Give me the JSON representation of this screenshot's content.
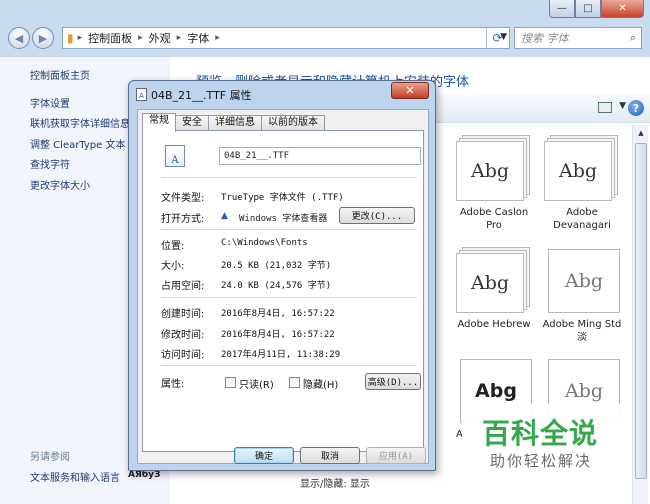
{
  "explorer": {
    "controls": {
      "minimize": "—",
      "maximize": "□",
      "close": "✕"
    },
    "breadcrumb": [
      "控制面板",
      "外观",
      "字体"
    ],
    "search_placeholder": "搜索 字体",
    "sidebar": {
      "home": "控制面板主页",
      "links": [
        "字体设置",
        "联机获取字体详细信息",
        "调整 ClearType 文本",
        "查找字符",
        "更改字体大小"
      ],
      "see_also_title": "另请参阅",
      "see_also_links": [
        "文本服务和输入语言"
      ]
    },
    "main_title": "预览、删除或者显示和隐藏计算机上安装的字体",
    "fonts": [
      {
        "sample": "Abg",
        "name": "Adobe Caslon Pro"
      },
      {
        "sample": "Abg",
        "name": "Adobe Devanagari"
      },
      {
        "sample": "Abg",
        "name": "Adobe Hebrew"
      },
      {
        "sample": "Abg",
        "name": "Adobe Ming Std 淡"
      },
      {
        "sample": "Abg",
        "name": "A"
      },
      {
        "sample": "Abg",
        "name": ""
      }
    ],
    "status_text": "显示/隐藏: 显示"
  },
  "dialog": {
    "title": "04B_21__.TTF 属性",
    "close": "✕",
    "tabs": [
      "常规",
      "安全",
      "详细信息",
      "以前的版本"
    ],
    "filename": "04B_21__.TTF",
    "rows": {
      "type_label": "文件类型:",
      "type_value": "TrueType 字体文件 (.TTF)",
      "open_label": "打开方式:",
      "open_value": "Windows 字体查看器",
      "change_btn": "更改(C)...",
      "location_label": "位置:",
      "location_value": "C:\\Windows\\Fonts",
      "size_label": "大小:",
      "size_value": "20.5 KB (21,032 字节)",
      "disk_label": "占用空间:",
      "disk_value": "24.0 KB (24,576 字节)",
      "created_label": "创建时间:",
      "created_value": "2016年8月4日, 16:57:22",
      "modified_label": "修改时间:",
      "modified_value": "2016年8月4日, 16:57:22",
      "accessed_label": "访问时间:",
      "accessed_value": "2017年4月11日, 11:38:29",
      "attr_label": "属性:",
      "readonly": "只读(R)",
      "hidden": "隐藏(H)",
      "advanced_btn": "高级(D)..."
    },
    "buttons": {
      "ok": "确定",
      "cancel": "取消",
      "apply": "应用(A)"
    }
  },
  "watermark": {
    "big": "百科全说",
    "small": "助你轻松解决"
  },
  "bottom_fragment": "AЯбуЗ",
  "colors": {
    "accent": "#1f4fa0",
    "watermark_green": "#35a84b"
  }
}
